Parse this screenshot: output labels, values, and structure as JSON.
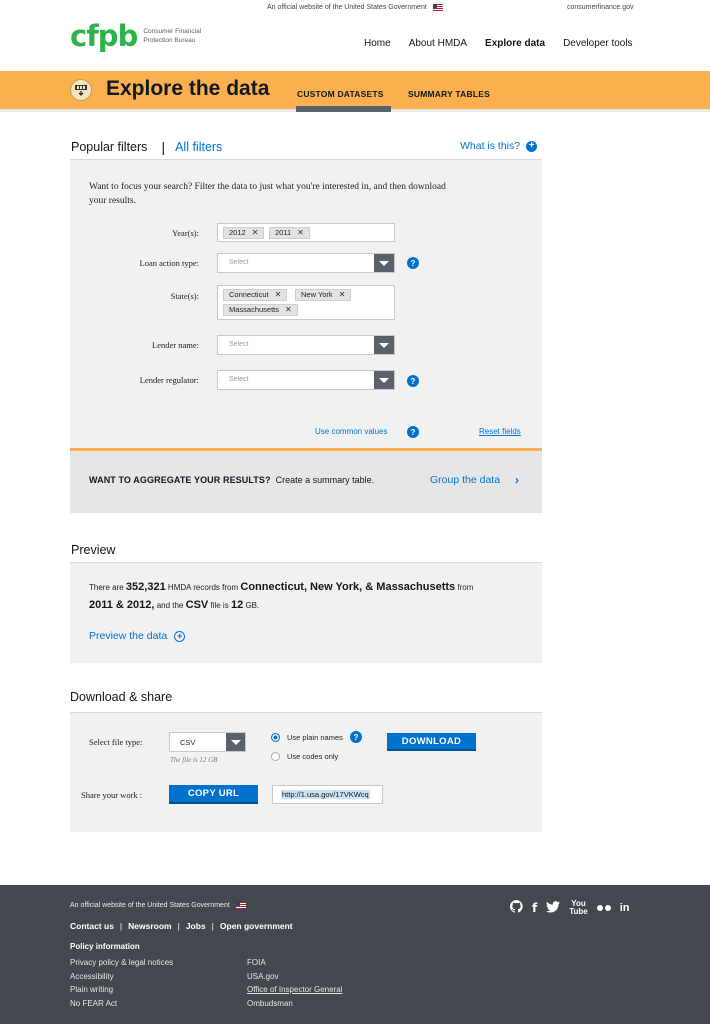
{
  "gov_banner": {
    "text": "An official website of the United States Government",
    "site": "consumerfinance.gov"
  },
  "logo": {
    "mark": "cfpb",
    "line1": "Consumer Financial",
    "line2": "Protection Bureau"
  },
  "nav": {
    "items": [
      "Home",
      "About HMDA",
      "Explore data",
      "Developer tools"
    ],
    "active": "Explore data"
  },
  "band": {
    "title": "Explore the data",
    "tabs": [
      "CUSTOM DATASETS",
      "SUMMARY TABLES"
    ],
    "active_tab": "CUSTOM DATASETS"
  },
  "filters": {
    "popular": "Popular filters",
    "separator": "|",
    "all": "All filters",
    "what_is_this": "What is this?",
    "intro": "Want to focus your search?  Filter the data to just what you're interested in, and then download your results.",
    "years_label": "Year(s):",
    "years": [
      "2012",
      "2011"
    ],
    "loan_action_label": "Loan action type:",
    "loan_action_placeholder": "Select",
    "states_label": "State(s):",
    "states": [
      "Connecticut",
      "New York",
      "Massachusetts"
    ],
    "lender_name_label": "Lender name:",
    "lender_name_placeholder": "Select",
    "lender_regulator_label": "Lender regulator:",
    "lender_regulator_placeholder": "Select",
    "use_common_values": "Use common values",
    "reset_fields": "Reset fields",
    "chip_remove": "✕",
    "help": "?"
  },
  "aggregate": {
    "bold": "WANT TO AGGREGATE YOUR RESULTS?",
    "rest": "Create a summary table.",
    "link": "Group the data",
    "chevron": "›"
  },
  "preview": {
    "title": "Preview",
    "there_are": "There are",
    "count": "352,321",
    "records_from": "HMDA records from",
    "states_text": "Connecticut, New York, & Massachusetts",
    "from": "from",
    "years_text": "2011 & 2012,",
    "and_the": "and the",
    "file_type": "CSV",
    "file_is": "file is",
    "size": "12",
    "unit": "GB.",
    "link": "Preview the data"
  },
  "download": {
    "title": "Download & share",
    "file_type_label": "Select file type:",
    "file_type_value": "CSV",
    "file_note": "The file is 12 GB",
    "radio_plain": "Use plain names",
    "radio_codes": "Use codes only",
    "download_button": "DOWNLOAD",
    "share_label": "Share your work :",
    "copy_button": "COPY URL",
    "share_url": "http://1.usa.gov/17VKWcq"
  },
  "footer": {
    "gov_text": "An official website of the United States Government",
    "links": [
      "Contact us",
      "Newsroom",
      "Jobs",
      "Open government"
    ],
    "policy_title": "Policy information",
    "col1": [
      "Privacy policy & legal notices",
      "Accessibility",
      "Plain writing",
      "No FEAR Act"
    ],
    "col2": [
      "FOIA",
      "USA.gov",
      "Office of Inspector General",
      "Ombudsman"
    ],
    "social": [
      "github-icon",
      "facebook-icon",
      "twitter-icon",
      "youtube-icon",
      "flickr-icon",
      "linkedin-icon"
    ]
  }
}
